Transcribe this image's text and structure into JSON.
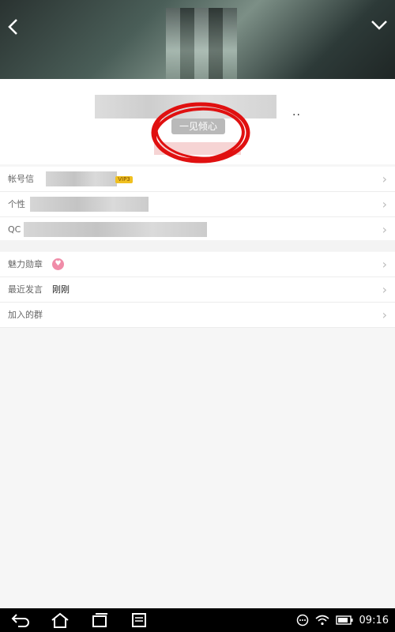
{
  "header": {
    "back_icon": "chevron-left-icon",
    "menu_icon": "chevron-down-icon"
  },
  "profile": {
    "more_glyph": "..",
    "tag_label": "一见倾心"
  },
  "info_rows": [
    {
      "label": "帐号信",
      "badge": "VIP3"
    },
    {
      "label": "个性",
      "badge": ""
    },
    {
      "label": "QC",
      "badge": ""
    }
  ],
  "social_rows": [
    {
      "label": "魅力勋章",
      "value": "",
      "icon": "heart-badge-icon"
    },
    {
      "label": "最近发言",
      "value": "刚刚",
      "icon": ""
    },
    {
      "label": "加入的群",
      "value": "",
      "icon": ""
    }
  ],
  "chevron": "›",
  "status_bar": {
    "time": "09:16",
    "icons": [
      "more-circle-icon",
      "wifi-icon",
      "battery-icon"
    ]
  },
  "nav_icons": [
    "back-icon",
    "home-icon",
    "recent-apps-icon",
    "menu-icon"
  ]
}
